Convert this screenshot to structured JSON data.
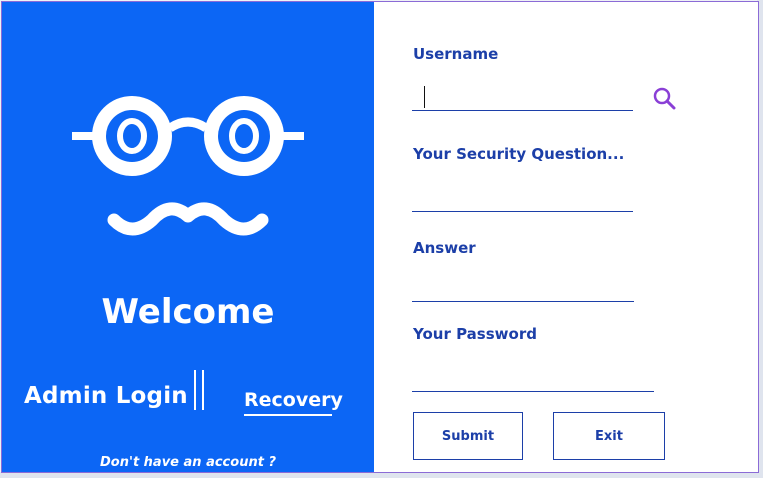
{
  "left_panel": {
    "welcome": "Welcome",
    "admin_login": "Admin Login",
    "recovery": "Recovery",
    "no_account": "Don't have an account ?",
    "logo_icon": "glasses-mustache-logo-icon"
  },
  "form": {
    "username_label": "Username",
    "username_value": "",
    "security_question_label": "Your Security Question...",
    "security_question_value": "",
    "answer_label": "Answer",
    "answer_value": "",
    "password_label": "Your Password",
    "password_value": "",
    "search_icon": "search-icon",
    "submit_label": "Submit",
    "exit_label": "Exit"
  },
  "colors": {
    "panel_blue": "#0c66f5",
    "label_blue": "#1c3fa8",
    "search_purple": "#8a3fd6"
  }
}
